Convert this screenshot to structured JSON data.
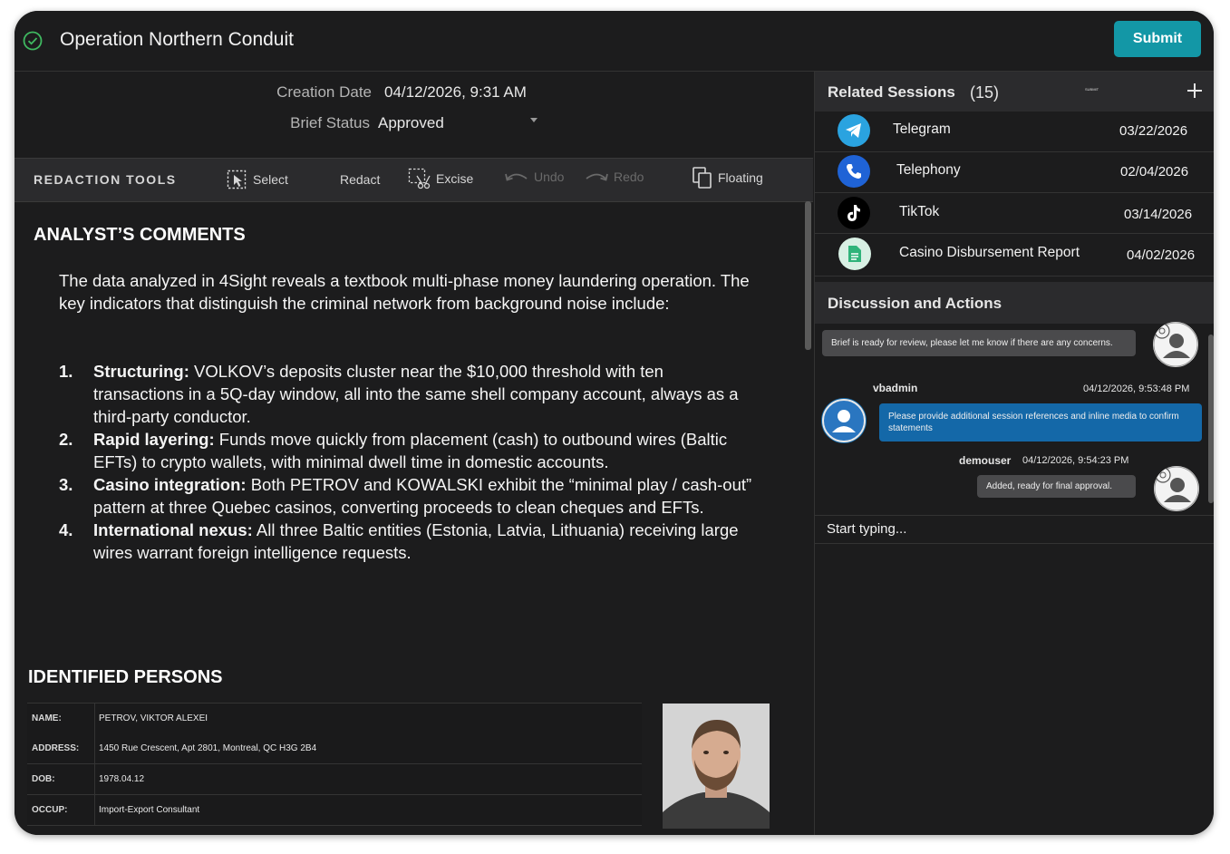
{
  "app": {
    "title": "Operation Northern Conduit",
    "submit_label": "Submit"
  },
  "meta": {
    "creation_label": "Creation Date",
    "creation_value": "04/12/2026, 9:31 AM",
    "status_label": "Brief Status",
    "status_value": "Approved"
  },
  "toolbar": {
    "title": "REDACTION TOOLS",
    "select": "Select",
    "redact": "Redact",
    "excise": "Excise",
    "undo": "Undo",
    "redo": "Redo",
    "floating": "Floating"
  },
  "comments": {
    "heading": "ANALYST’S COMMENTS",
    "intro": "The data analyzed in 4Sight reveals a textbook multi-phase money laundering operation. The key indicators that distinguish the criminal network from background noise include:",
    "items": [
      {
        "num": "1.",
        "bold": "Structuring:",
        "text": " VOLKOV’s deposits cluster near the $10,000 threshold with ten transactions in a 5Q-day window, all into the same shell company account, always as a third-party conductor."
      },
      {
        "num": "2.",
        "bold": "Rapid layering:",
        "text": " Funds move quickly from placement (cash) to outbound wires (Baltic EFTs) to crypto wallets, with minimal dwell time in domestic accounts."
      },
      {
        "num": "3.",
        "bold": "Casino integration:",
        "text": " Both PETROV and KOWALSKI exhibit the “minimal play / cash-out” pattern at three Quebec casinos, converting proceeds to clean cheques and EFTs."
      },
      {
        "num": "4.",
        "bold": "International nexus:",
        "text": " All three Baltic entities (Estonia, Latvia, Lithuania) receiving large wires warrant foreign intelligence requests."
      }
    ]
  },
  "persons": {
    "heading": "IDENTIFIED PERSONS",
    "rows": [
      {
        "key": "NAME:",
        "value": "PETROV, VIKTOR ALEXEI"
      },
      {
        "key": "ADDRESS:",
        "value": "1450 Rue Crescent, Apt 2801, Montreal, QC H3G 2B4"
      },
      {
        "key": "DOB:",
        "value": "1978.04.12"
      },
      {
        "key": "OCCUP:",
        "value": "Import-Export Consultant"
      }
    ]
  },
  "related": {
    "title": "Related Sessions",
    "count": "(15)",
    "tiny": "SUBMIT",
    "sessions": [
      {
        "name": "Telegram",
        "date": "03/22/2026",
        "icon": "telegram-icon"
      },
      {
        "name": "Telephony",
        "date": "02/04/2026",
        "icon": "phone-icon"
      },
      {
        "name": "TikTok",
        "date": "03/14/2026",
        "icon": "tiktok-icon"
      },
      {
        "name": "Casino Disbursement Report",
        "date": "04/02/2026",
        "icon": "document-icon"
      }
    ]
  },
  "discussion": {
    "title": "Discussion and Actions",
    "messages": [
      {
        "text": "Brief is ready for review, please let me know if there are any concerns."
      },
      {
        "user": "vbadmin",
        "time": "04/12/2026, 9:53:48 PM",
        "text": "Please provide additional session references and inline media to confirm statements"
      },
      {
        "user": "demouser",
        "time": "04/12/2026, 9:54:23 PM",
        "text": "Added, ready for final approval."
      }
    ],
    "input_placeholder": "Start typing..."
  },
  "colors": {
    "accent": "#1397a6",
    "bubble_blue": "#1468a8",
    "background": "#1c1c1d"
  }
}
